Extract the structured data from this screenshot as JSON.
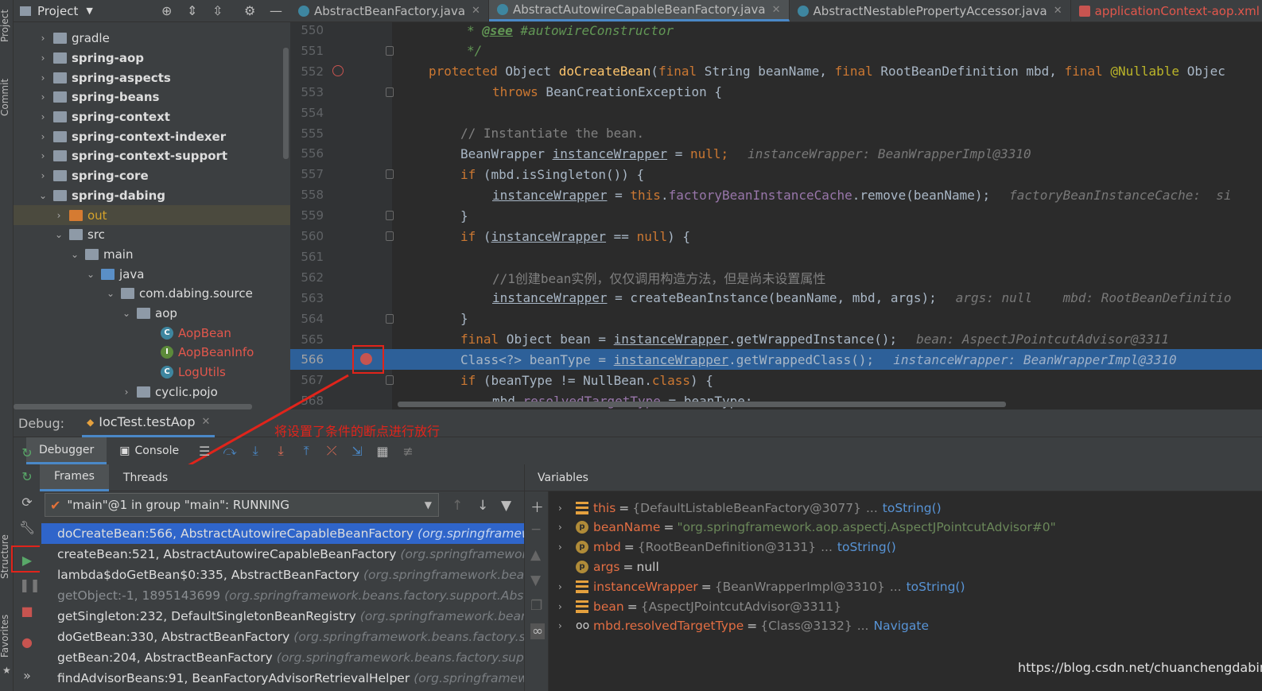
{
  "left_strip": {
    "project_label": "Project",
    "commit_label": "Commit",
    "structure_label": "Structure",
    "favorites_label": "Favorites"
  },
  "project": {
    "title": "Project",
    "tree": [
      {
        "label": "gradle",
        "type": "folder"
      },
      {
        "label": "spring-aop",
        "type": "module"
      },
      {
        "label": "spring-aspects",
        "type": "module"
      },
      {
        "label": "spring-beans",
        "type": "module"
      },
      {
        "label": "spring-context",
        "type": "module"
      },
      {
        "label": "spring-context-indexer",
        "type": "module"
      },
      {
        "label": "spring-context-support",
        "type": "module"
      },
      {
        "label": "spring-core",
        "type": "module"
      },
      {
        "label": "spring-dabing",
        "type": "module"
      },
      {
        "label": "out",
        "type": "out"
      },
      {
        "label": "src",
        "type": "folder"
      },
      {
        "label": "main",
        "type": "folder"
      },
      {
        "label": "java",
        "type": "source"
      },
      {
        "label": "com.dabing.source",
        "type": "package"
      },
      {
        "label": "aop",
        "type": "package"
      },
      {
        "label": "AopBean",
        "type": "class"
      },
      {
        "label": "AopBeanInfo",
        "type": "interface"
      },
      {
        "label": "LogUtils",
        "type": "class"
      },
      {
        "label": "cyclic.pojo",
        "type": "package"
      }
    ]
  },
  "editor": {
    "tabs": [
      {
        "label": "AbstractBeanFactory.java"
      },
      {
        "label": "AbstractAutowireCapableBeanFactory.java"
      },
      {
        "label": "AbstractNestablePropertyAccessor.java"
      },
      {
        "label": "applicationContext-aop.xml"
      }
    ],
    "line_numbers": [
      "550",
      "551",
      "552",
      "553",
      "554",
      "555",
      "556",
      "557",
      "558",
      "559",
      "560",
      "561",
      "562",
      "563",
      "564",
      "565",
      "566",
      "567",
      "568"
    ],
    "lines": {
      "l550_tag": "@see",
      "l550_rest": " #autowireConstructor",
      "l550_star": "* ",
      "l551": "*/",
      "l552_kw": "protected",
      "l552_a": " Object ",
      "l552_fn": "doCreateBean",
      "l552_b": "(",
      "l552_kw2": "final",
      "l552_c": " String beanName, ",
      "l552_kw3": "final",
      "l552_d": " RootBeanDefinition mbd, ",
      "l552_kw4": "final",
      "l552_ann": " @Nullable",
      "l552_e": " Objec",
      "l553_kw": "throws",
      "l553_rest": " BeanCreationException {",
      "l555": "// Instantiate the bean.",
      "l556_a": "BeanWrapper ",
      "l556_var": "instanceWrapper",
      "l556_b": " = ",
      "l556_kw": "null",
      "l556_c": ";",
      "l556_hint": "instanceWrapper: BeanWrapperImpl@3310",
      "l557_kw": "if",
      "l557_rest": " (mbd.isSingleton()) {",
      "l558_var": "instanceWrapper",
      "l558_a": " = ",
      "l558_kw": "this",
      "l558_b": ".",
      "l558_fld": "factoryBeanInstanceCache",
      "l558_c": ".remove(beanName);",
      "l558_hint": "factoryBeanInstanceCache:  si",
      "l559": "}",
      "l560_kw": "if",
      "l560_a": " (",
      "l560_var": "instanceWrapper",
      "l560_b": " == ",
      "l560_kw2": "null",
      "l560_c": ") {",
      "l562": "//1创建bean实例，仅仅调用构造方法，但是尚未设置属性",
      "l563_var": "instanceWrapper",
      "l563_a": " = createBeanInstance(beanName, mbd, args);",
      "l563_hint": "args: null    mbd: RootBeanDefinitio",
      "l564": "}",
      "l565_kw": "final",
      "l565_a": " Object bean = ",
      "l565_var": "instanceWrapper",
      "l565_b": ".getWrappedInstance();",
      "l565_hint": "bean: AspectJPointcutAdvisor@3311",
      "l566_a": "Class<?> beanType = ",
      "l566_var": "instanceWrapper",
      "l566_b": ".getWrappedClass();",
      "l566_hint": "instanceWrapper: BeanWrapperImpl@3310",
      "l567_kw": "if",
      "l567_a": " (beanType != NullBean.",
      "l567_kw2": "class",
      "l567_b": ") {",
      "l568_a": "mbd.",
      "l568_fld": "resolvedTargetType",
      "l568_b": " = beanType;"
    }
  },
  "debug": {
    "label": "Debug:",
    "session": "IocTest.testAop",
    "annotation": "将设置了条件的断点进行放行",
    "tabs": {
      "debugger": "Debugger",
      "console": "Console"
    },
    "frames_tabs": {
      "frames": "Frames",
      "threads": "Threads"
    },
    "thread": "\"main\"@1 in group \"main\": RUNNING",
    "frames": [
      {
        "method": "doCreateBean:566, AbstractAutowireCapableBeanFactory",
        "pkg": "(org.springframework.b"
      },
      {
        "method": "createBean:521, AbstractAutowireCapableBeanFactory",
        "pkg": "(org.springframework.bea"
      },
      {
        "method": "lambda$doGetBean$0:335, AbstractBeanFactory",
        "pkg": "(org.springframework.beans.fact"
      },
      {
        "method": "getObject:-1, 1895143699",
        "pkg": "(org.springframework.beans.factory.support.AbstractB"
      },
      {
        "method": "getSingleton:232, DefaultSingletonBeanRegistry",
        "pkg": "(org.springframework.beans.fact"
      },
      {
        "method": "doGetBean:330, AbstractBeanFactory",
        "pkg": "(org.springframework.beans.factory.suppor"
      },
      {
        "method": "getBean:204, AbstractBeanFactory",
        "pkg": "(org.springframework.beans.factory.support)"
      },
      {
        "method": "findAdvisorBeans:91, BeanFactoryAdvisorRetrievalHelper",
        "pkg": "(org.springframework.a"
      }
    ],
    "variables_title": "Variables",
    "variables": [
      {
        "name": "this",
        "value": "{DefaultListableBeanFactory@3077}",
        "extra": "... toString()",
        "icon": "field",
        "expandable": true
      },
      {
        "name": "beanName",
        "value": "\"org.springframework.aop.aspectj.AspectJPointcutAdvisor#0\"",
        "extra": "",
        "icon": "param",
        "expandable": true
      },
      {
        "name": "mbd",
        "value": "{RootBeanDefinition@3131}",
        "extra": "... toString()",
        "icon": "param",
        "expandable": true
      },
      {
        "name": "args",
        "value": "null",
        "extra": "",
        "icon": "param",
        "expandable": false
      },
      {
        "name": "instanceWrapper",
        "value": "{BeanWrapperImpl@3310}",
        "extra": "... toString()",
        "icon": "field",
        "expandable": true
      },
      {
        "name": "bean",
        "value": "{AspectJPointcutAdvisor@3311}",
        "extra": "",
        "icon": "field",
        "expandable": true
      },
      {
        "name": "mbd.resolvedTargetType",
        "value": "{Class@3132}",
        "extra": "... Navigate",
        "icon": "glasses",
        "expandable": true
      }
    ]
  },
  "watermark": "https://blog.csdn.net/chuanchengdabing"
}
